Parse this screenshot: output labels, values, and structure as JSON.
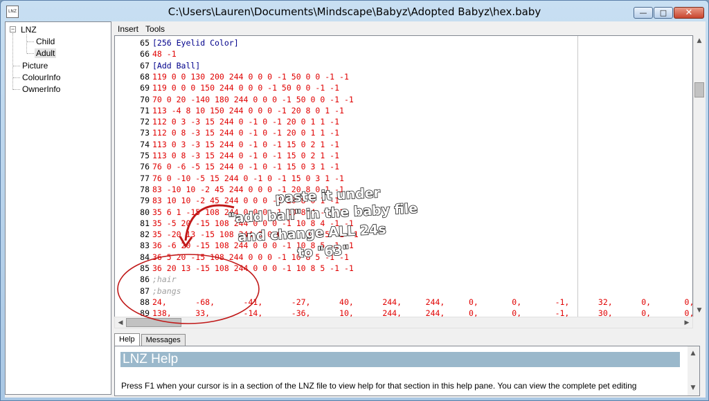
{
  "window": {
    "title": "C:\\Users\\Lauren\\Documents\\Mindscape\\Babyz\\Adopted Babyz\\hex.baby",
    "icon_text": "LNZ",
    "minimize": "—",
    "maximize": "□",
    "close": "✕"
  },
  "tree": {
    "root": "LNZ",
    "child": "Child",
    "adult": "Adult",
    "picture": "Picture",
    "colourinfo": "ColourInfo",
    "ownerinfo": "OwnerInfo"
  },
  "menu": {
    "insert": "Insert",
    "tools": "Tools"
  },
  "editor": {
    "lines": [
      {
        "n": "65",
        "t": "[256 Eyelid Color]",
        "k": "section"
      },
      {
        "n": "66",
        "t": "48 -1",
        "k": "num"
      },
      {
        "n": "67",
        "t": "[Add Ball]",
        "k": "section"
      },
      {
        "n": "68",
        "t": "119 0 0 130 200 244 0 0 0 -1 50 0 0 -1 -1",
        "k": "num"
      },
      {
        "n": "69",
        "t": "119 0 0 0 150 244 0 0 0 -1 50 0 0 -1 -1",
        "k": "num"
      },
      {
        "n": "70",
        "t": "70 0 20 -140 180 244 0 0 0 -1 50 0 0 -1 -1",
        "k": "num"
      },
      {
        "n": "71",
        "t": "113 -4 8 10 150 244 0 0 0 -1 20 8 0 1 -1",
        "k": "num"
      },
      {
        "n": "72",
        "t": "112 0 3 -3 15 244 0 -1 0 -1 20 0 1 1 -1",
        "k": "num"
      },
      {
        "n": "73",
        "t": "112 0 8 -3 15 244 0 -1 0 -1 20 0 1 1 -1",
        "k": "num"
      },
      {
        "n": "74",
        "t": "113 0 3 -3 15 244 0 -1 0 -1 15 0 2 1 -1",
        "k": "num"
      },
      {
        "n": "75",
        "t": "113 0 8 -3 15 244 0 -1 0 -1 15 0 2 1 -1",
        "k": "num"
      },
      {
        "n": "76",
        "t": "76 0 -6 -5 15 244 0 -1 0 -1 15 0 3 1 -1",
        "k": "num"
      },
      {
        "n": "77",
        "t": "76 0 -10 -5 15 244 0 -1 0 -1 15 0 3 1 -1",
        "k": "num"
      },
      {
        "n": "78",
        "t": "83 -10 10 -2 45 244 0 0 0 -1 20 8 0 1 -1",
        "k": "num"
      },
      {
        "n": "79",
        "t": "83 10 10 -2 45 244 0 0 0 -1 20 8 0 1 -1",
        "k": "num"
      },
      {
        "n": "80",
        "t": "35 6 1 -15 108 244 0 0 0 -1 10 8 4 -1 -1",
        "k": "num"
      },
      {
        "n": "81",
        "t": "35 -5 20 -15 108 244 0 0 0 -1 10 8 4 -1 -1",
        "k": "num"
      },
      {
        "n": "82",
        "t": "35 -20 13 -15 108 244 0 0 0 -1 10 8 5 -1 -1",
        "k": "num"
      },
      {
        "n": "83",
        "t": "36 -6 20 -15 108 244 0 0 0 -1 10 8 5 -1 -1",
        "k": "num"
      },
      {
        "n": "84",
        "t": "36 5 20 -15 108 244 0 0 0 -1 10 8 5 -1 -1",
        "k": "num"
      },
      {
        "n": "85",
        "t": "36 20 13 -15 108 244 0 0 0 -1 10 8 5 -1 -1",
        "k": "num"
      },
      {
        "n": "86",
        "t": ";hair",
        "k": "comment"
      },
      {
        "n": "87",
        "t": ";bangs",
        "k": "comment"
      },
      {
        "n": "88",
        "t": "24,      -68,      -41,      -27,      40,      244,     244,     0,       0,       -1,      32,      0,       0,",
        "k": "num"
      },
      {
        "n": "89",
        "t": "138,     33,       -14,      -36,      10,      244,     244,     0,       0,       -1,      30,      0,       0,",
        "k": "num"
      }
    ]
  },
  "tabs": {
    "help": "Help",
    "messages": "Messages"
  },
  "help": {
    "title": "LNZ Help",
    "text": "Press F1 when your cursor is in a section of the LNZ file to view help for that section in this help pane. You can view the complete pet editing"
  },
  "annotation": {
    "line1": "paste it under",
    "line2": "\"add ball\" in the baby file",
    "line3": "and change ALL 24s",
    "line4": "to \"63\"",
    "color": "#c01818"
  }
}
